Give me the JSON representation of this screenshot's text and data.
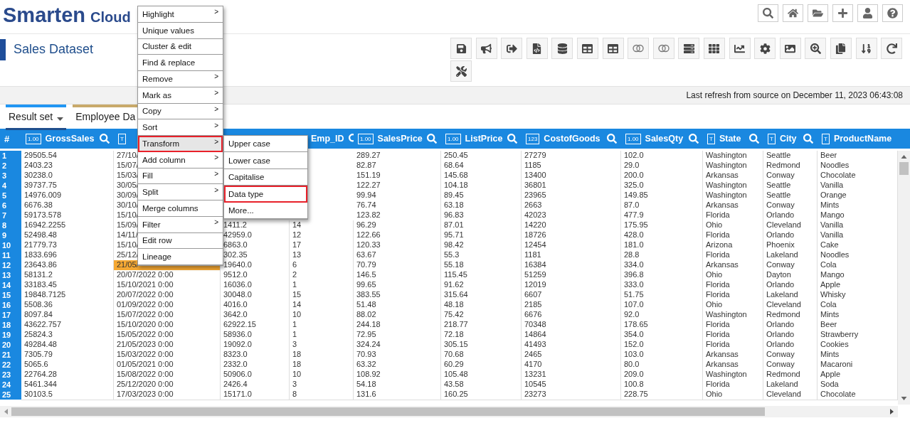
{
  "brand": {
    "name": "Smarten",
    "suffix": "Cloud"
  },
  "page_title": "Sales Dataset",
  "refresh_text": "Last refresh from source on  December 11, 2023 06:43:08",
  "tabs": [
    {
      "label": "Result set",
      "selected": true,
      "color": "#2196f3"
    },
    {
      "label": "Employee Da",
      "selected": false,
      "color": "#c8a96a"
    }
  ],
  "table": {
    "corner": "#",
    "columns": [
      {
        "type": "1.00",
        "name": "GrossSales",
        "search_icon": true
      },
      {
        "type": "T"
      },
      {},
      {
        "name": "Emp_ID",
        "search_icon": true
      },
      {
        "type": "1.00",
        "name": "SalesPrice",
        "search_icon": true
      },
      {
        "type": "1.00",
        "name": "ListPrice",
        "search_icon": true
      },
      {
        "type": "123",
        "name": "CostofGoods",
        "search_icon": true
      },
      {
        "type": "1.00",
        "name": "SalesQty",
        "search_icon": true
      },
      {
        "type": "T",
        "name": "State",
        "search_icon": true
      },
      {
        "type": "T",
        "name": "City",
        "search_icon": true
      },
      {
        "type": "T",
        "name": "ProductName"
      }
    ],
    "rows": [
      {
        "number": "1",
        "cells": [
          "29505.54",
          "27/10/",
          null,
          null,
          "289.27",
          "250.45",
          "27279",
          "102.0",
          "Washington",
          "Seattle",
          "Beer"
        ]
      },
      {
        "number": "2",
        "cells": [
          "2403.23",
          "15/07/",
          null,
          null,
          "82.87",
          "68.64",
          "1185",
          "29.0",
          "Washington",
          "Redmond",
          "Noodles"
        ]
      },
      {
        "number": "3",
        "cells": [
          "30238.0",
          "15/03/",
          null,
          null,
          "151.19",
          "145.68",
          "13400",
          "200.0",
          "Arkansas",
          "Conway",
          "Chocolate"
        ]
      },
      {
        "number": "4",
        "cells": [
          "39737.75",
          "30/05/",
          null,
          null,
          "122.27",
          "104.18",
          "36801",
          "325.0",
          "Washington",
          "Seattle",
          "Vanilla"
        ]
      },
      {
        "number": "5",
        "cells": [
          "14976.009",
          "30/09/",
          null,
          null,
          "99.94",
          "89.45",
          "23965",
          "149.85",
          "Washington",
          "Seattle",
          "Orange"
        ]
      },
      {
        "number": "6",
        "cells": [
          "6676.38",
          "30/10/",
          null,
          null,
          "76.74",
          "63.18",
          "2663",
          "87.0",
          "Arkansas",
          "Conway",
          "Mints"
        ]
      },
      {
        "number": "7",
        "cells": [
          "59173.578",
          "15/10/",
          null,
          null,
          "123.82",
          "96.83",
          "42023",
          "477.9",
          "Florida",
          "Orlando",
          "Mango"
        ]
      },
      {
        "number": "8",
        "cells": [
          "16942.2255",
          "15/09/",
          "1411.2",
          "14",
          "96.29",
          "87.01",
          "14220",
          "175.95",
          "Ohio",
          "Cleveland",
          "Vanilla"
        ]
      },
      {
        "number": "9",
        "cells": [
          "52498.48",
          "14/11/",
          "42959.0",
          "12",
          "122.66",
          "95.71",
          "18726",
          "428.0",
          "Florida",
          "Orlando",
          "Vanilla"
        ]
      },
      {
        "number": "10",
        "cells": [
          "21779.73",
          "15/10/",
          "6863.0",
          "17",
          "120.33",
          "98.42",
          "12454",
          "181.0",
          "Arizona",
          "Phoenix",
          "Cake"
        ]
      },
      {
        "number": "11",
        "cells": [
          "1833.696",
          "25/12/",
          "302.35",
          "13",
          "63.67",
          "55.3",
          "1181",
          "28.8",
          "Florida",
          "Lakeland",
          "Noodles"
        ]
      },
      {
        "number": "12",
        "cells": [
          "23643.86",
          {
            "text": "21/05/",
            "highlighted": true
          },
          "19640.0",
          "6",
          "70.79",
          "55.18",
          "16384",
          "334.0",
          "Arkansas",
          "Conway",
          "Cola"
        ]
      },
      {
        "number": "13",
        "cells": [
          "58131.2",
          "20/07/2022 0:00",
          "9512.0",
          "2",
          "146.5",
          "115.45",
          "51259",
          "396.8",
          "Ohio",
          "Dayton",
          "Mango"
        ]
      },
      {
        "number": "14",
        "cells": [
          "33183.45",
          "15/10/2021 0:00",
          "16036.0",
          "1",
          "99.65",
          "91.62",
          "12019",
          "333.0",
          "Florida",
          "Orlando",
          "Apple"
        ]
      },
      {
        "number": "15",
        "cells": [
          "19848.7125",
          "20/07/2022 0:00",
          "30048.0",
          "15",
          "383.55",
          "315.64",
          "6607",
          "51.75",
          "Florida",
          "Lakeland",
          "Whisky"
        ]
      },
      {
        "number": "16",
        "cells": [
          "5508.36",
          "01/09/2022 0:00",
          "4016.0",
          "14",
          "51.48",
          "48.18",
          "2185",
          "107.0",
          "Ohio",
          "Cleveland",
          "Cola"
        ]
      },
      {
        "number": "17",
        "cells": [
          "8097.84",
          "15/07/2022 0:00",
          "3642.0",
          "10",
          "88.02",
          "75.42",
          "6676",
          "92.0",
          "Washington",
          "Redmond",
          "Mints"
        ]
      },
      {
        "number": "18",
        "cells": [
          "43622.757",
          "15/10/2020 0:00",
          "62922.15",
          "1",
          "244.18",
          "218.77",
          "70348",
          "178.65",
          "Florida",
          "Orlando",
          "Beer"
        ]
      },
      {
        "number": "19",
        "cells": [
          "25824.3",
          "15/05/2022 0:00",
          "58936.0",
          "1",
          "72.95",
          "72.18",
          "14864",
          "354.0",
          "Florida",
          "Orlando",
          "Strawberry"
        ]
      },
      {
        "number": "20",
        "cells": [
          "49284.48",
          "21/05/2023 0:00",
          "19092.0",
          "3",
          "324.24",
          "305.15",
          "41493",
          "152.0",
          "Florida",
          "Orlando",
          "Cookies"
        ]
      },
      {
        "number": "21",
        "cells": [
          "7305.79",
          "15/03/2022 0:00",
          "8323.0",
          "18",
          "70.93",
          "70.68",
          "2465",
          "103.0",
          "Arkansas",
          "Conway",
          "Mints"
        ]
      },
      {
        "number": "22",
        "cells": [
          "5065.6",
          "01/05/2021 0:00",
          "2332.0",
          "18",
          "63.32",
          "60.29",
          "4170",
          "80.0",
          "Arkansas",
          "Conway",
          "Macaroni"
        ]
      },
      {
        "number": "23",
        "cells": [
          "22764.28",
          "15/08/2022 0:00",
          "50906.0",
          "10",
          "108.92",
          "105.48",
          "13231",
          "209.0",
          "Washington",
          "Redmond",
          "Apple"
        ]
      },
      {
        "number": "24",
        "cells": [
          "5461.344",
          "25/12/2020 0:00",
          "2426.4",
          "3",
          "54.18",
          "43.58",
          "10545",
          "100.8",
          "Florida",
          "Lakeland",
          "Soda"
        ]
      },
      {
        "number": "25",
        "cells": [
          "30103.5",
          "17/03/2023 0:00",
          "15171.0",
          "8",
          "131.6",
          "160.25",
          "23273",
          "228.75",
          "Ohio",
          "Cleveland",
          "Chocolate"
        ]
      }
    ]
  },
  "context_menu": {
    "items": [
      {
        "label": "Highlight",
        "arrow": ">",
        "selected": false
      },
      {
        "label": "Unique values",
        "selected": false
      },
      {
        "label": "Cluster & edit",
        "selected": false
      },
      {
        "label": "Find & replace",
        "selected": false
      },
      {
        "label": "Remove",
        "arrow": ">",
        "selected": false
      },
      {
        "label": "Mark as",
        "arrow": ">",
        "selected": false
      },
      {
        "label": "Copy",
        "arrow": ">",
        "selected": false
      },
      {
        "label": "Sort",
        "arrow": ">",
        "selected": false
      },
      {
        "label": "Transform",
        "arrow": ">",
        "selected": true
      },
      {
        "label": "Add column",
        "arrow": ">",
        "selected": false
      },
      {
        "label": "Fill",
        "arrow": ">",
        "selected": false
      },
      {
        "label": "Split",
        "arrow": ">",
        "selected": false
      },
      {
        "label": "Merge columns",
        "selected": false
      },
      {
        "label": "Filter",
        "arrow": ">",
        "selected": false
      },
      {
        "label": "Edit row",
        "selected": false
      },
      {
        "label": "Lineage",
        "selected": false
      }
    ]
  },
  "submenu": {
    "items": [
      {
        "label": "Upper case",
        "selected": false
      },
      {
        "label": "Lower case",
        "selected": false
      },
      {
        "label": "Capitalise",
        "selected": false
      },
      {
        "label": "Data type",
        "selected": true
      },
      {
        "label": "More...",
        "selected": false
      }
    ]
  }
}
